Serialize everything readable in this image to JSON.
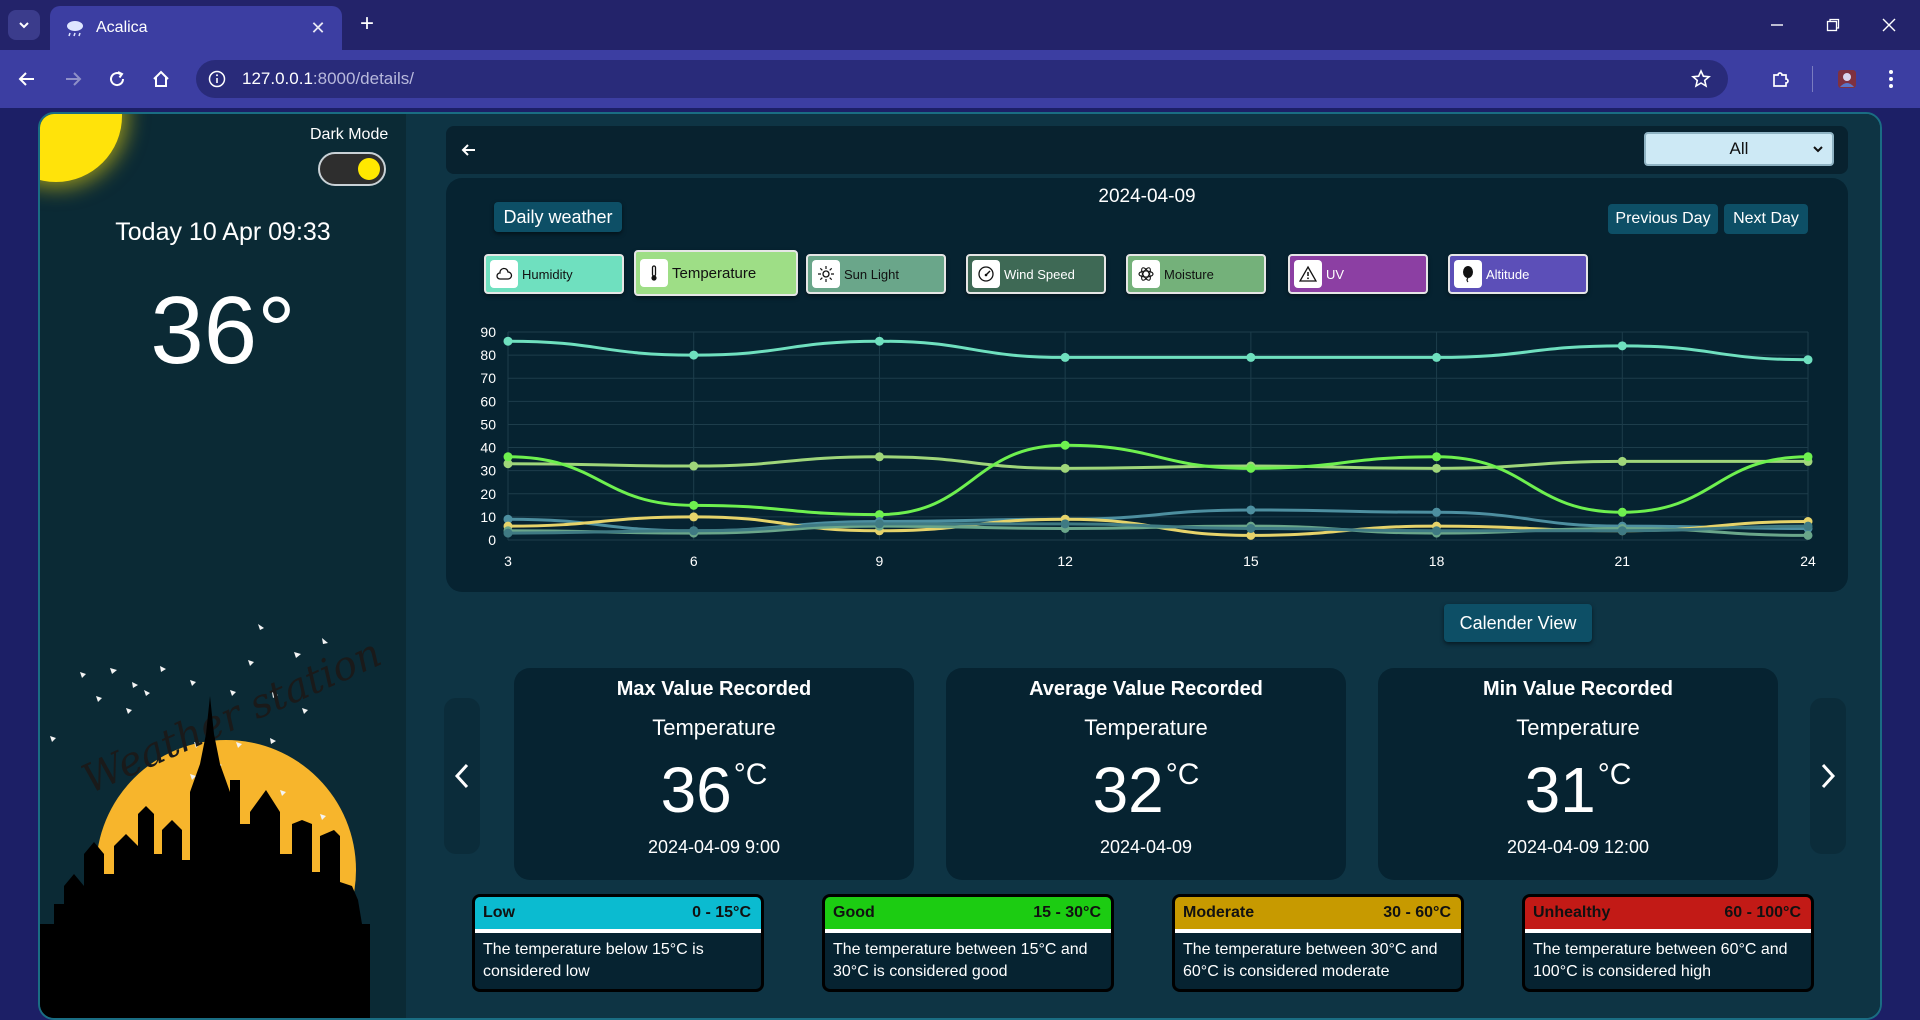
{
  "browser": {
    "tab_title": "Acalica",
    "url_host": "127.0.0.1",
    "url_path": ":8000/details/"
  },
  "sidebar": {
    "dark_mode_label": "Dark Mode",
    "dark_mode_on": true,
    "today": "Today 10 Apr 09:33",
    "current_temp": "36°",
    "logo_text": "Weather station"
  },
  "filter": {
    "selected": "All"
  },
  "chart": {
    "date": "2024-04-09",
    "daily_label": "Daily weather",
    "prev_label": "Previous Day",
    "next_label": "Next Day",
    "metrics": [
      {
        "label": "Humidity",
        "color": "#6fe0bf",
        "icon": "cloud-icon",
        "active": false
      },
      {
        "label": "Temperature",
        "color": "#9ede86",
        "icon": "thermometer-icon",
        "active": true
      },
      {
        "label": "Sun Light",
        "color": "#6aa68a",
        "icon": "sun-icon",
        "active": false
      },
      {
        "label": "Wind Speed",
        "color": "#3e6955",
        "icon": "gauge-icon",
        "active": false
      },
      {
        "label": "Moisture",
        "color": "#74b17a",
        "icon": "atom-icon",
        "active": false
      },
      {
        "label": "UV",
        "color": "#8c3fa3",
        "icon": "warning-icon",
        "active": false
      },
      {
        "label": "Altitude",
        "color": "#5c4fb8",
        "icon": "balloon-icon",
        "active": false
      }
    ]
  },
  "chart_data": {
    "type": "line",
    "x": [
      3,
      6,
      9,
      12,
      15,
      18,
      21,
      24
    ],
    "ylim": [
      0,
      90
    ],
    "yticks": [
      0,
      10,
      20,
      30,
      40,
      50,
      60,
      70,
      80,
      90
    ],
    "grid": true,
    "series": [
      {
        "color": "#6fe0bf",
        "values": [
          86,
          80,
          86,
          79,
          79,
          79,
          84,
          78
        ]
      },
      {
        "color": "#9fd67a",
        "values": [
          33,
          32,
          36,
          31,
          32,
          31,
          34,
          34
        ]
      },
      {
        "color": "#6ef04f",
        "values": [
          36,
          15,
          11,
          41,
          31,
          36,
          12,
          36
        ]
      },
      {
        "color": "#4d8fa0",
        "values": [
          9,
          4,
          8,
          9,
          13,
          12,
          6,
          5
        ]
      },
      {
        "color": "#e6d36a",
        "values": [
          6,
          10,
          4,
          9,
          2,
          6,
          4,
          8
        ]
      },
      {
        "color": "#6aa68a",
        "values": [
          4,
          3,
          6,
          5,
          6,
          3,
          5,
          2
        ]
      },
      {
        "color": "#3f7a83",
        "values": [
          3,
          4,
          7,
          7,
          5,
          4,
          4,
          6
        ]
      }
    ]
  },
  "calendar_label": "Calender View",
  "stats": [
    {
      "title": "Max Value Recorded",
      "metric": "Temperature",
      "value": "36",
      "unit": "°C",
      "date": "2024-04-09 9:00"
    },
    {
      "title": "Average Value Recorded",
      "metric": "Temperature",
      "value": "32",
      "unit": "°C",
      "date": "2024-04-09"
    },
    {
      "title": "Min Value Recorded",
      "metric": "Temperature",
      "value": "31",
      "unit": "°C",
      "date": "2024-04-09 12:00"
    }
  ],
  "ranges": [
    {
      "level": "Low",
      "range": "0 - 15°C",
      "color": "#0bbbd0",
      "text": "The temperature below 15°C is considered low"
    },
    {
      "level": "Good",
      "range": "15 - 30°C",
      "color": "#1ccc12",
      "text": "The temperature between 15°C and 30°C is considered good"
    },
    {
      "level": "Moderate",
      "range": "30 - 60°C",
      "color": "#c79a00",
      "text": "The temperature between 30°C and 60°C is considered moderate"
    },
    {
      "level": "Unhealthy",
      "range": "60 - 100°C",
      "color": "#c21a16",
      "text": "The temperature between 60°C and 100°C is considered high"
    }
  ]
}
